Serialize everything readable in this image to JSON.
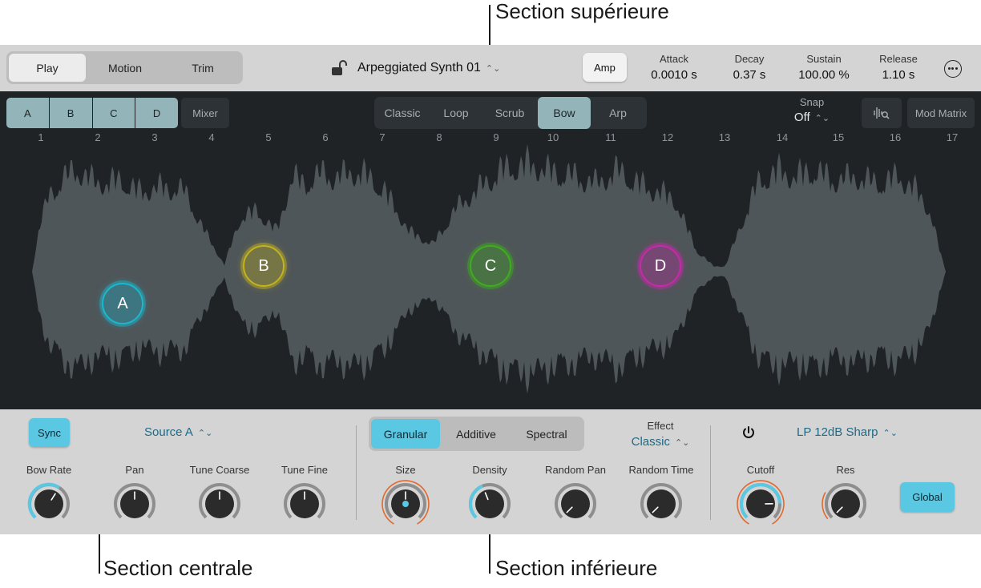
{
  "callouts": {
    "top": "Section supérieure",
    "middle": "Section centrale",
    "bottom": "Section inférieure"
  },
  "top": {
    "mode_tabs": [
      "Play",
      "Motion",
      "Trim"
    ],
    "active_mode": "Play",
    "lock_icon": "unlocked-padlock-icon",
    "preset_name": "Arpeggiated Synth 01",
    "amp_button": "Amp",
    "envelope": [
      {
        "label": "Attack",
        "value": "0.0010 s"
      },
      {
        "label": "Decay",
        "value": "0.37 s"
      },
      {
        "label": "Sustain",
        "value": "100.00 %"
      },
      {
        "label": "Release",
        "value": "1.10 s"
      }
    ],
    "more_icon": "ellipsis-circle-icon"
  },
  "middle": {
    "sources": [
      "A",
      "B",
      "C",
      "D"
    ],
    "mixer_button": "Mixer",
    "play_modes": [
      "Classic",
      "Loop",
      "Scrub",
      "Bow",
      "Arp"
    ],
    "active_play_mode": "Bow",
    "snap": {
      "label": "Snap",
      "value": "Off"
    },
    "waveform_zoom_icon": "waveform-magnifier-icon",
    "mod_matrix_button": "Mod Matrix",
    "ruler": [
      "1",
      "2",
      "3",
      "4",
      "5",
      "6",
      "7",
      "8",
      "9",
      "10",
      "11",
      "12",
      "13",
      "14",
      "15",
      "16",
      "17"
    ],
    "markers": [
      {
        "label": "A",
        "color": "#1bb8cf"
      },
      {
        "label": "B",
        "color": "#c4b31f"
      },
      {
        "label": "C",
        "color": "#3fae1e"
      },
      {
        "label": "D",
        "color": "#c62aa8"
      }
    ],
    "waveform_color": "#4f5659"
  },
  "bottom": {
    "sync_button": "Sync",
    "source_select": "Source A",
    "synthesis_tabs": [
      "Granular",
      "Additive",
      "Spectral"
    ],
    "active_synthesis": "Granular",
    "effect": {
      "label": "Effect",
      "value": "Classic"
    },
    "power_icon": "power-icon",
    "filter_select": "LP 12dB Sharp",
    "global_button": "Global",
    "accent_color": "#5ac8e2",
    "mod_color": "#e2692b",
    "knobs": [
      {
        "label": "Bow Rate",
        "level": 0.62
      },
      {
        "label": "Pan",
        "level": 0.5
      },
      {
        "label": "Tune Coarse",
        "level": 0.5
      },
      {
        "label": "Tune Fine",
        "level": 0.5
      },
      {
        "label": "Size",
        "level": 0.5
      },
      {
        "label": "Density",
        "level": 0.42
      },
      {
        "label": "Random Pan",
        "level": 0.0
      },
      {
        "label": "Random Time",
        "level": 0.0
      },
      {
        "label": "Cutoff",
        "level": 0.83
      },
      {
        "label": "Res",
        "level": 0.0
      }
    ]
  }
}
